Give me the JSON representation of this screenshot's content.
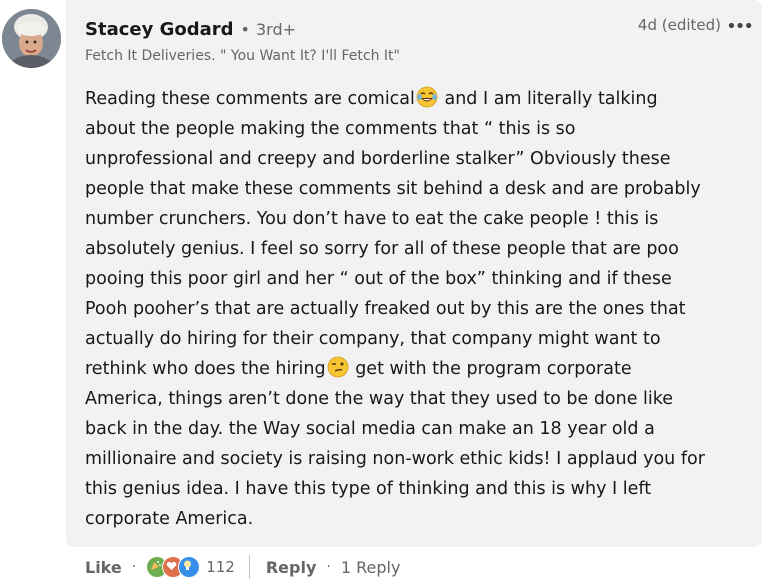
{
  "comment": {
    "author": {
      "name": "Stacey Godard",
      "separator": "•",
      "degree": "3rd+",
      "headline": "Fetch It Deliveries. \" You Want It? I'll Fetch It\""
    },
    "time": "4d (edited)",
    "more_icon": "•••",
    "body_lines": [
      "Reading these comments are comical",
      "and I am literally talking",
      "about the people making the comments that “ this is so",
      "unprofessional and creepy and borderline stalker” Obviously these",
      "people that make these comments sit behind a desk and are probably",
      "number crunchers. You don’t have to eat the cake people ! this is",
      "absolutely genius. I feel so sorry for all of these people that are poo",
      "pooing this poor girl and her “ out of the box” thinking and if these",
      "Pooh pooher’s that are actually freaked out by this are the ones that",
      "actually do hiring for their company, that company might want to",
      "rethink who does the hiring",
      "get with the program corporate",
      "America, things aren’t done the way that they used to be done like",
      "back in the day. the Way social media can make an 18 year old a",
      "millionaire and society is raising non-work ethic kids! I applaud you for",
      "this genius idea. I have this type of thinking and this is why I left",
      "corporate America."
    ],
    "emojis": [
      "laughing-tears-emoji",
      "smirk-emoji"
    ],
    "actions": {
      "like_label": "Like",
      "dot": "·",
      "reaction_count": "112",
      "reaction_icons": [
        "celebrate-icon",
        "love-icon",
        "insightful-icon"
      ],
      "reply_label": "Reply",
      "reply_count": "1 Reply"
    },
    "colors": {
      "card_bg": "#f2f2f2",
      "meta_gray": "#666666",
      "celebrate": "#44712e",
      "love": "#df704d",
      "insightful": "#378fe9"
    }
  }
}
